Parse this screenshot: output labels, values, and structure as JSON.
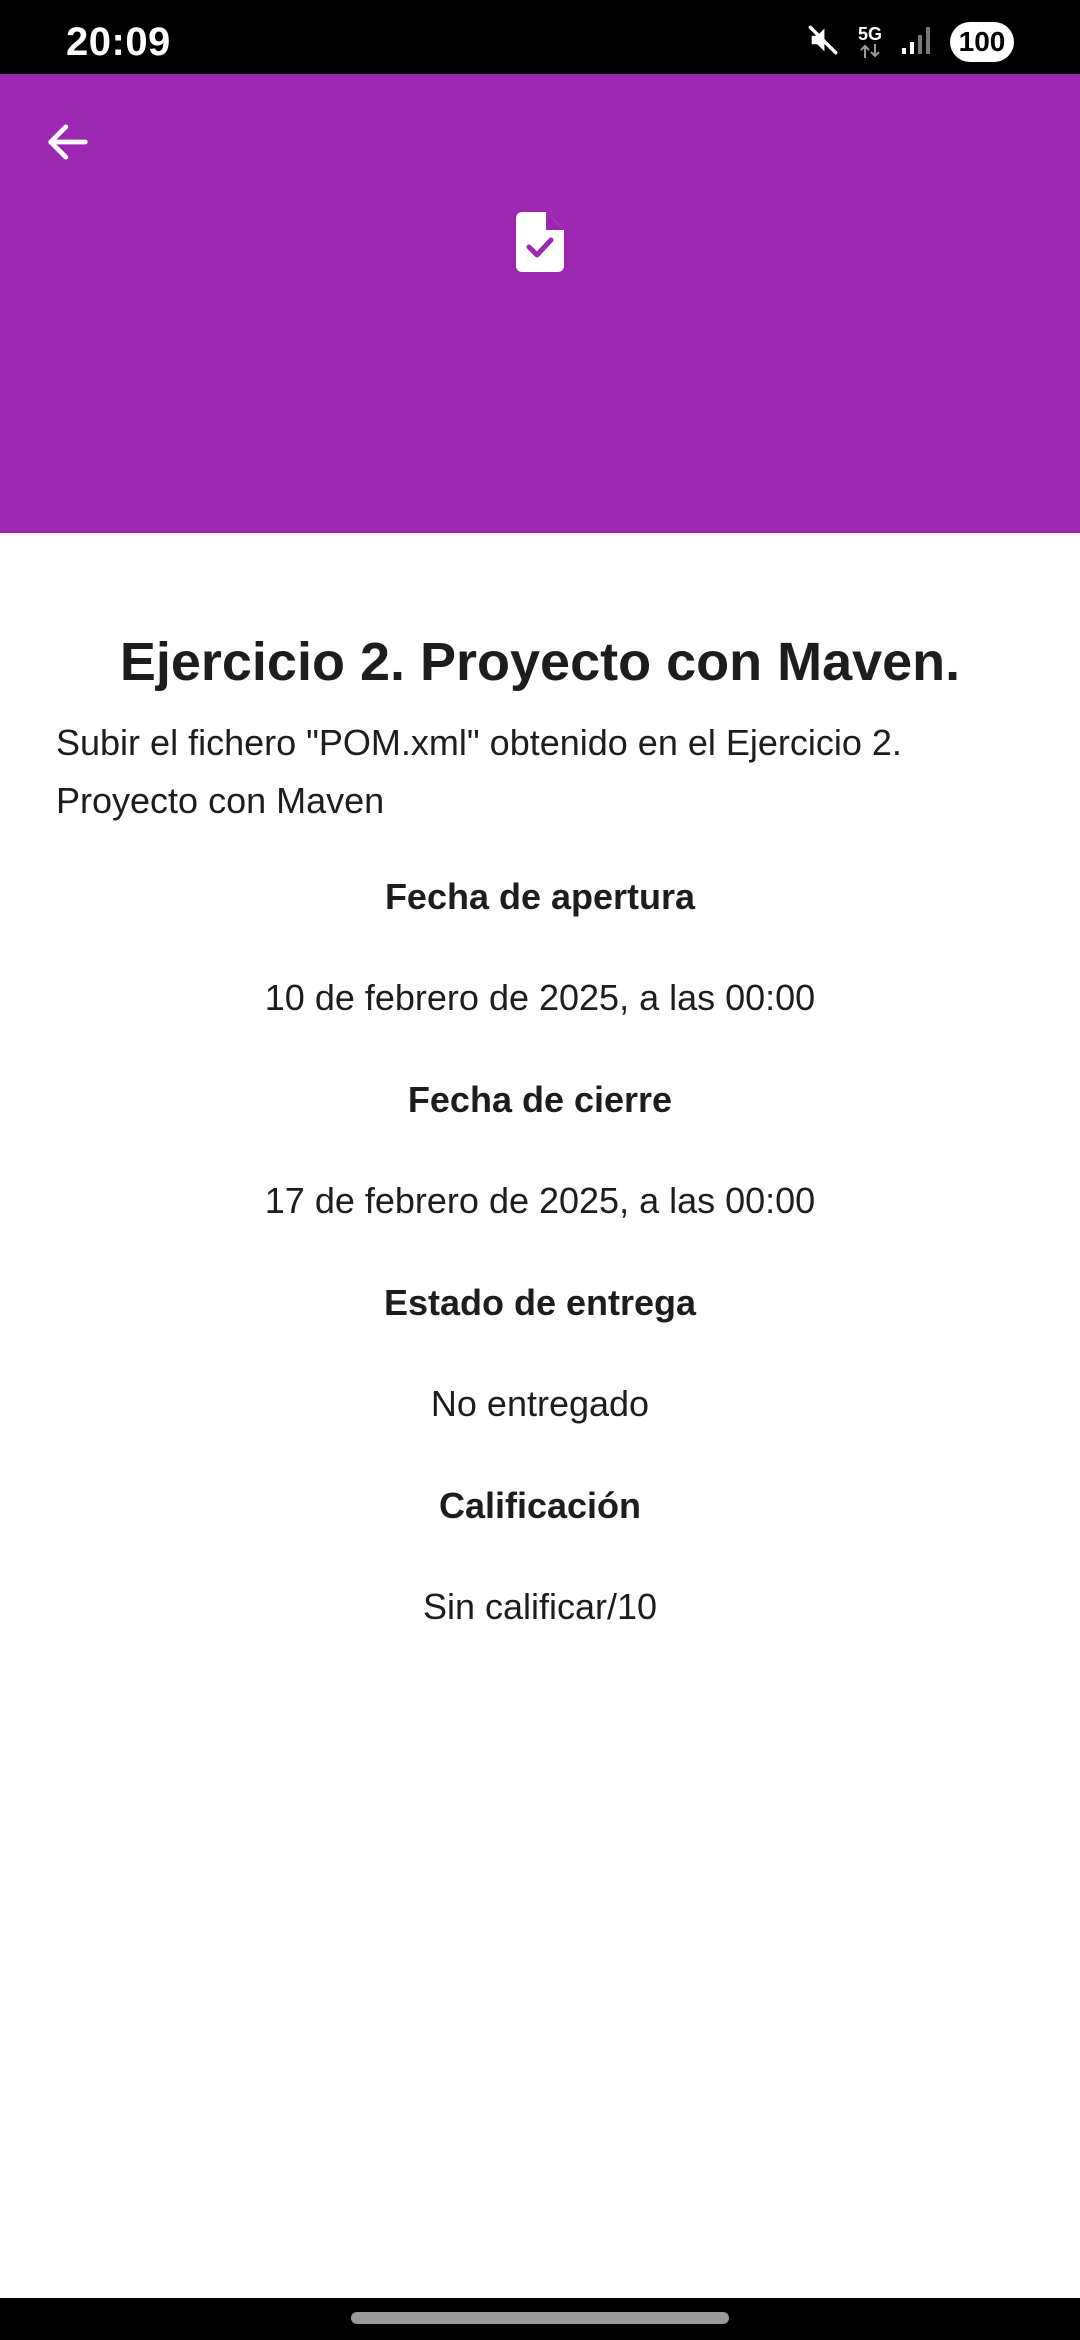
{
  "status_bar": {
    "time": "20:09",
    "network": "5G",
    "battery": "100",
    "icons": [
      "mute-icon",
      "network-5g-icon",
      "signal-icon",
      "battery-icon"
    ]
  },
  "header": {
    "background_color": "#9c27b0",
    "back_icon": "arrow-back-icon",
    "assignment_icon": "assignment-check-icon"
  },
  "assignment": {
    "title": "Ejercicio 2. Proyecto con Maven.",
    "description": "Subir el fichero \"POM.xml\" obtenido en el Ejercicio 2. Proyecto con Maven",
    "fields": [
      {
        "label": "Fecha de apertura",
        "value": "10 de febrero de 2025, a las 00:00"
      },
      {
        "label": "Fecha de cierre",
        "value": "17 de febrero de 2025, a las 00:00"
      },
      {
        "label": "Estado de entrega",
        "value": "No entregado"
      },
      {
        "label": "Calificación",
        "value": "Sin calificar/10"
      }
    ]
  }
}
